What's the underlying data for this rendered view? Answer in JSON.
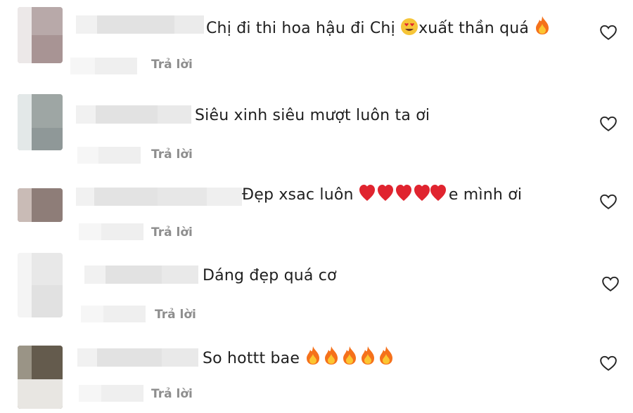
{
  "comments": [
    {
      "text_before": "Chị đi thi hoa hậu đi Chị ",
      "text_after": "xuất thần quá ",
      "reply_label": "Trả lời"
    },
    {
      "text": "Siêu xinh siêu mượt luôn ta ơi",
      "reply_label": "Trả lời"
    },
    {
      "text_before": "Đẹp xsac luôn ",
      "text_after": "e mình ơi",
      "reply_label": "Trả lời"
    },
    {
      "text": "Dáng đẹp quá cơ",
      "reply_label": "Trả lời"
    },
    {
      "text": "So hottt bae ",
      "reply_label": "Trả lời"
    }
  ],
  "icons": {
    "like": "heart-outline-icon",
    "fire": "fire-emoji",
    "heart": "red-heart-emoji",
    "heart_eyes": "heart-eyes-emoji"
  },
  "colors": {
    "reply": "#8e8e8e",
    "text": "#1f1f1f",
    "fire": "#f5711b",
    "heart": "#e0242f",
    "blur": "#e6e6e6"
  }
}
